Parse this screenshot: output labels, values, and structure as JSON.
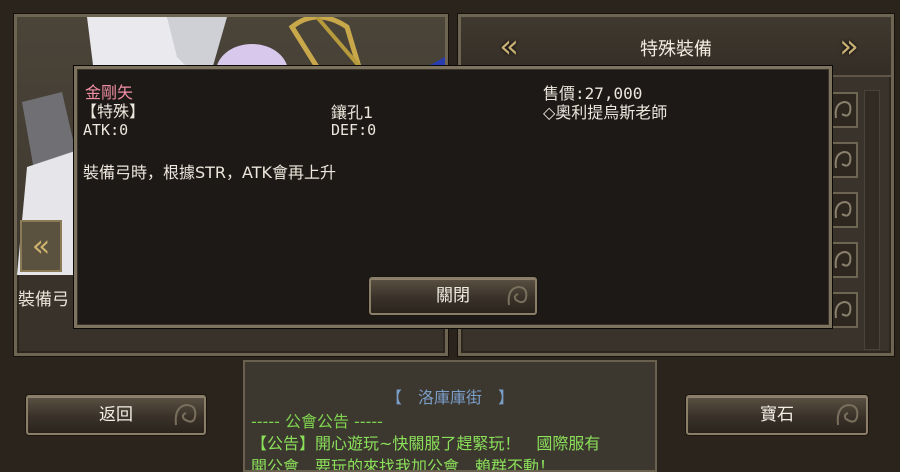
{
  "header": {
    "title": "特殊裝備"
  },
  "left_panel": {
    "equip_label": "裝備弓"
  },
  "popup": {
    "name": "金剛矢",
    "type": "【特殊】",
    "sockets": "鑲孔1",
    "price": "售價:27,000",
    "vendor": "◇奧利提烏斯老師",
    "atk": "ATK:0",
    "def": "DEF:0",
    "description": "裝備弓時，根據STR，ATK會再上升",
    "close_label": "關閉"
  },
  "buttons": {
    "back": "返回",
    "gem": "寶石"
  },
  "chat": {
    "title": "【　洛庫庫街　】",
    "separator": "-----  公會公告  -----",
    "line1": "【公告】開心遊玩~快關服了趕緊玩！　國際服有",
    "line2": "開公會　要玩的來找我加公會　賴群不動！"
  }
}
